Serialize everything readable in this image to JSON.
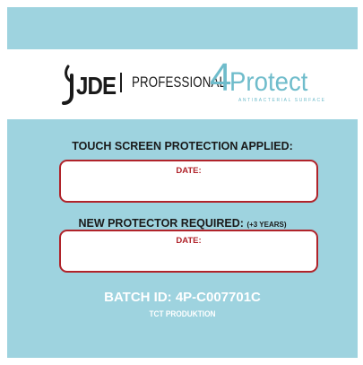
{
  "logos": {
    "brand": "JDE",
    "divider": "|",
    "division": "PROFESSIONAL",
    "product_four": "4",
    "product_word": "Protect",
    "product_tagline": "ANTIBACTERIAL SURFACE"
  },
  "sections": {
    "applied_heading": "TOUCH SCREEN PROTECTION APPLIED:",
    "applied_date_label": "DATE:",
    "required_heading": "NEW PROTECTOR REQUIRED:",
    "required_note": "(+3 YEARS)",
    "required_date_label": "DATE:"
  },
  "footer": {
    "batch_id": "BATCH ID: 4P-C007701C",
    "producer": "TCT PRODUKTION"
  },
  "colors": {
    "background": "#9ed3df",
    "band": "#ffffff",
    "accent_red": "#b0232a",
    "protect_blue": "#6fbccb",
    "text_dark": "#1a1a1a"
  }
}
